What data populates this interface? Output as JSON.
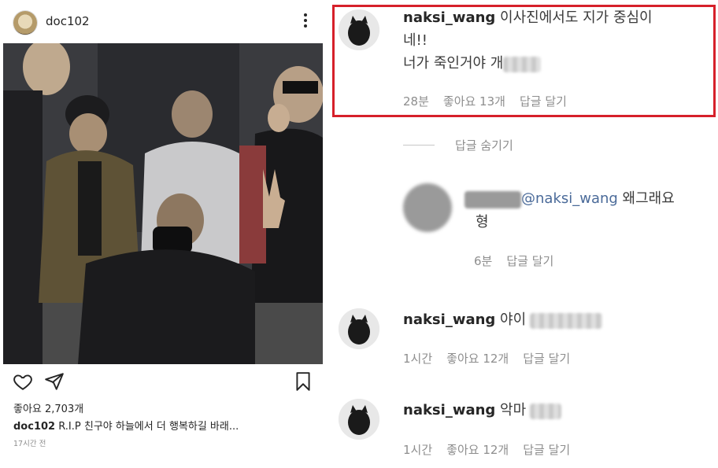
{
  "post": {
    "username": "doc102",
    "likes": "좋아요 2,703개",
    "caption_user": "doc102",
    "caption_text": " R.I.P 친구야 하늘에서 더 행복하길 바래...",
    "time": "17시간 전"
  },
  "comments": {
    "first": {
      "username": "naksi_wang",
      "text_line1": " 이사진에서도 지가 중심이",
      "text_line2": "네!!",
      "text_line3": "너가 죽인거야 개",
      "time": "28분",
      "likes": "좋아요 13개",
      "reply": "답글 달기"
    },
    "hide_replies": "답글 숨기기",
    "reply": {
      "mention": "@naksi_wang",
      "text": " 왜그래요",
      "text_line2": "형",
      "time": "6분",
      "reply": "답글 달기"
    },
    "second": {
      "username": "naksi_wang",
      "text": " 야이",
      "time": "1시간",
      "likes": "좋아요 12개",
      "reply": "답글 달기"
    },
    "third": {
      "username": "naksi_wang",
      "text": " 악마",
      "time": "1시간",
      "likes": "좋아요 12개",
      "reply": "답글 달기"
    }
  },
  "colors": {
    "highlight": "#d6202a",
    "meta": "#8e8e8e",
    "text": "#262626"
  }
}
